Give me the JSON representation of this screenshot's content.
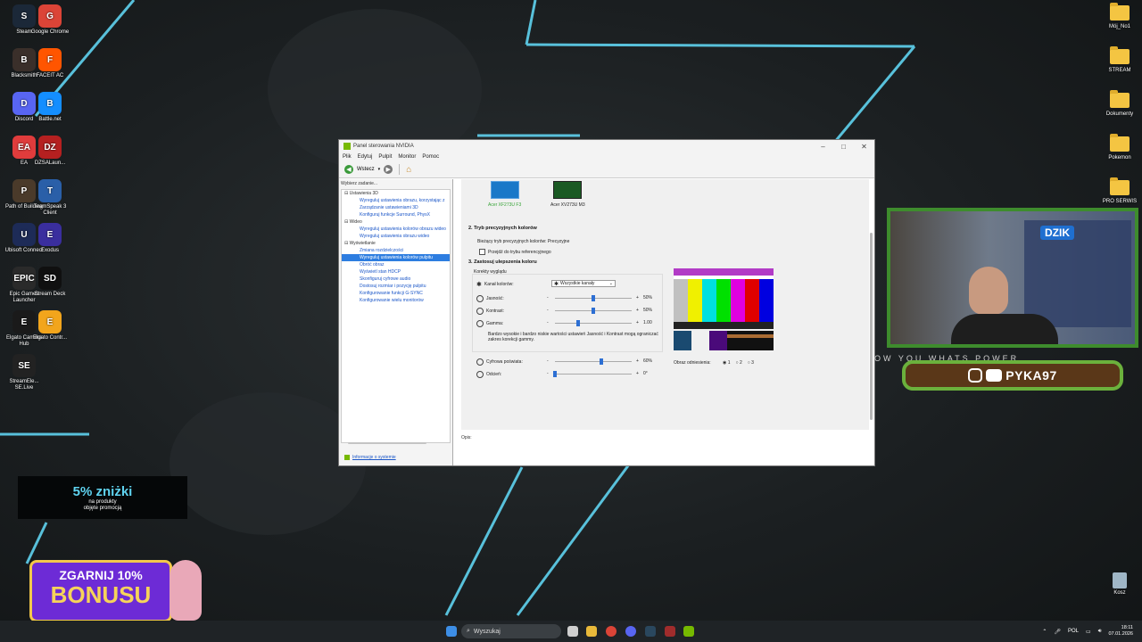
{
  "desktop": {
    "left_icons": [
      {
        "label": "Steam",
        "color": "#1b2838",
        "glyph": "S"
      },
      {
        "label": "Google Chrome",
        "color": "#db4437",
        "glyph": "G"
      },
      {
        "label": "Blacksmith",
        "color": "#3a2f2a",
        "glyph": "B"
      },
      {
        "label": "FACEIT AC",
        "color": "#ff5500",
        "glyph": "F"
      },
      {
        "label": "Discord",
        "color": "#5865f2",
        "glyph": "D"
      },
      {
        "label": "Battle.net",
        "color": "#148eff",
        "glyph": "B"
      },
      {
        "label": "EA",
        "color": "#e03c3c",
        "glyph": "EA"
      },
      {
        "label": "DZSALaun...",
        "color": "#b52020",
        "glyph": "DZ"
      },
      {
        "label": "Path of Building",
        "color": "#4a3a2a",
        "glyph": "P"
      },
      {
        "label": "TeamSpeak 3 Client",
        "color": "#2a5fa8",
        "glyph": "T"
      },
      {
        "label": "Ubisoft Connect",
        "color": "#1d2b57",
        "glyph": "U"
      },
      {
        "label": "Exodus",
        "color": "#3a2e9e",
        "glyph": "E"
      },
      {
        "label": "Epic Games Launcher",
        "color": "#2a2a2a",
        "glyph": "EPIC"
      },
      {
        "label": "Stream Deck",
        "color": "#101010",
        "glyph": "SD"
      },
      {
        "label": "Elgato Camera Hub",
        "color": "#1a1a1a",
        "glyph": "E"
      },
      {
        "label": "Elgato Contr...",
        "color": "#f2a51c",
        "glyph": "E"
      },
      {
        "label": "StreamEle... SE.Live",
        "color": "#222",
        "glyph": "SE"
      }
    ],
    "right_icons": [
      {
        "label": "Mój_No1"
      },
      {
        "label": "STREAM"
      },
      {
        "label": "Dokumenty"
      },
      {
        "label": "Pokemon"
      },
      {
        "label": "PRO SERWIS"
      }
    ],
    "recycle_bin": "Kosz"
  },
  "promo": {
    "discount": "5% zniżki",
    "line1": "na produkty",
    "line2": "objęte promocją"
  },
  "bonus": {
    "line1": "ZGARNIJ 10%",
    "line2": "BONUSU"
  },
  "nvidia": {
    "title": "Panel sterowania NVIDIA",
    "menu": [
      "Plik",
      "Edytuj",
      "Pulpit",
      "Monitor",
      "Pomoc"
    ],
    "back_label": "Wstecz",
    "task_header": "Wybierz zadanie...",
    "tree": [
      {
        "type": "cat",
        "label": "Ustawienia 3D"
      },
      {
        "type": "item",
        "label": "Wyreguluj ustawienia obrazu, korzystając z"
      },
      {
        "type": "item",
        "label": "Zarządzanie ustawieniami 3D"
      },
      {
        "type": "item",
        "label": "Konfiguruj funkcje Surround, PhysX"
      },
      {
        "type": "cat",
        "label": "Wideo"
      },
      {
        "type": "item",
        "label": "Wyreguluj ustawienia kolorów obrazu wideo"
      },
      {
        "type": "item",
        "label": "Wyreguluj ustawienia obrazu wideo"
      },
      {
        "type": "cat",
        "label": "Wyświetlanie"
      },
      {
        "type": "item",
        "label": "Zmiana rozdzielczości"
      },
      {
        "type": "item",
        "label": "Wyreguluj ustawienia kolorów pulpitu",
        "selected": true
      },
      {
        "type": "item",
        "label": "Obróć obraz"
      },
      {
        "type": "item",
        "label": "Wyświetl stan HDCP"
      },
      {
        "type": "item",
        "label": "Skonfiguruj cyfrowe audio"
      },
      {
        "type": "item",
        "label": "Dostosuj rozmiar i pozycję pulpitu"
      },
      {
        "type": "item",
        "label": "Konfigurowanie funkcji G-SYNC"
      },
      {
        "type": "item",
        "label": "Konfigurowanie wielu monitorów"
      }
    ],
    "system_info": "Informacje o systemie",
    "monitors": [
      "Acer XF273U F3",
      "Acer XV273U M3"
    ],
    "section2": "2. Tryb precyzyjnych kolorów",
    "precise_mode_text": "Bieżący tryb precyzyjnych kolorów: Precyzyjne",
    "reference_checkbox": "Przejdź do trybu referencyjnego",
    "section3": "3. Zastosuj ulepszenia koloru",
    "color_group": "Korekty wyglądu",
    "channel_label": "Kanał kolorów:",
    "channel_value": "Wszystkie kanały",
    "sliders": [
      {
        "label": "Jasność:",
        "value": "50%",
        "level": 0.5,
        "icon": "brightness-icon"
      },
      {
        "label": "Kontrast:",
        "value": "50%",
        "level": 0.5,
        "icon": "contrast-icon"
      },
      {
        "label": "Gamma:",
        "value": "1.00",
        "level": 0.3,
        "icon": "gamma-icon"
      }
    ],
    "warning": "Bardzo wysokie i bardzo niskie wartości ustawień Jasność i Kontrast mogą ograniczać zakres korekcji gammy.",
    "sliders2": [
      {
        "label": "Cyfrowa poświata:",
        "value": "60%",
        "level": 0.6,
        "icon": "vibrance-icon"
      },
      {
        "label": "Odcień:",
        "value": "0°",
        "level": 0.0,
        "icon": "hue-icon"
      }
    ],
    "reference_label": "Obraz odniesienia:",
    "reference_options": [
      "1",
      "2",
      "3"
    ],
    "description_label": "Opis:"
  },
  "stream": {
    "handle": "PYKA97",
    "banner_logo": "DZIK",
    "ticker": "OW YOU WHATS POWER"
  },
  "taskbar": {
    "search_placeholder": "Wyszukaj",
    "lang": "POL",
    "time": "18:11",
    "date": "07.01.2026"
  }
}
